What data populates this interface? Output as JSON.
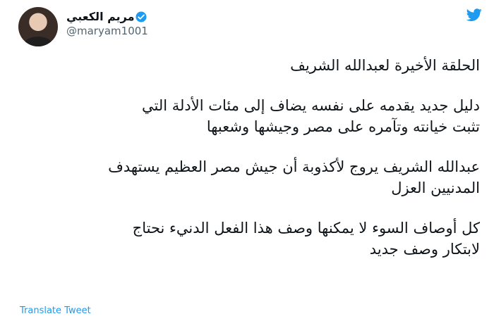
{
  "author": {
    "name": "مريم الكعبي",
    "handle": "@maryam1001",
    "verified": true
  },
  "tweet": {
    "paragraphs": [
      [
        "الحلقة الأخيرة لعبدالله الشريف"
      ],
      [
        "دليل جديد يقدمه على نفسه يضاف إلى مئات الأدلة التي",
        "تثبت خيانته وتآمره على مصر وجيشها وشعبها"
      ],
      [
        "عبدالله الشريف يروج لأكذوبة أن جيش مصر العظيم يستهدف",
        "المدنيين العزل"
      ],
      [
        "كل أوصاف السوء لا يمكنها وصف هذا الفعل الدنيء نحتاج",
        "لابتكار وصف جديد"
      ]
    ],
    "translate_label": "Translate Tweet"
  },
  "colors": {
    "accent": "#1d9bf0",
    "text": "#0f1419",
    "secondary": "#536471"
  },
  "icons": {
    "logo": "twitter-bird-icon",
    "verified": "verified-badge-icon"
  }
}
